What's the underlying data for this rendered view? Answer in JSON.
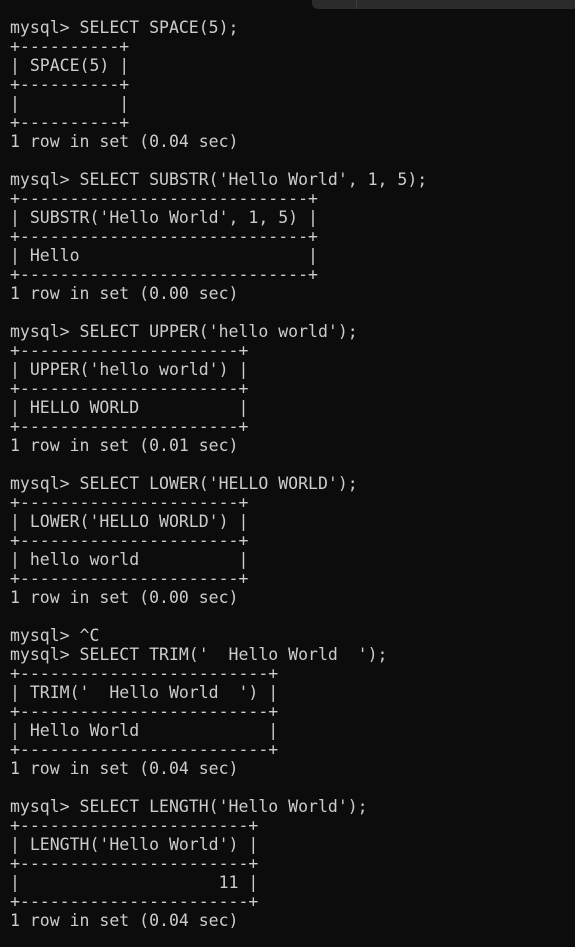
{
  "window": {
    "lines": [
      "mysql> SELECT SPACE(5);",
      "+----------+",
      "| SPACE(5) |",
      "+----------+",
      "|          |",
      "+----------+",
      "1 row in set (0.04 sec)",
      "",
      "mysql> SELECT SUBSTR('Hello World', 1, 5);",
      "+-----------------------------+",
      "| SUBSTR('Hello World', 1, 5) |",
      "+-----------------------------+",
      "| Hello                       |",
      "+-----------------------------+",
      "1 row in set (0.00 sec)",
      "",
      "mysql> SELECT UPPER('hello world');",
      "+----------------------+",
      "| UPPER('hello world') |",
      "+----------------------+",
      "| HELLO WORLD          |",
      "+----------------------+",
      "1 row in set (0.01 sec)",
      "",
      "mysql> SELECT LOWER('HELLO WORLD');",
      "+----------------------+",
      "| LOWER('HELLO WORLD') |",
      "+----------------------+",
      "| hello world          |",
      "+----------------------+",
      "1 row in set (0.00 sec)",
      "",
      "mysql> ^C",
      "mysql> SELECT TRIM('  Hello World  ');",
      "+-------------------------+",
      "| TRIM('  Hello World  ') |",
      "+-------------------------+",
      "| Hello World             |",
      "+-------------------------+",
      "1 row in set (0.04 sec)",
      "",
      "mysql> SELECT LENGTH('Hello World');",
      "+-----------------------+",
      "| LENGTH('Hello World') |",
      "+-----------------------+",
      "|                    11 |",
      "+-----------------------+",
      "1 row in set (0.04 sec)"
    ]
  },
  "colors": {
    "background": "#0c0c0c",
    "text": "#cccccc"
  }
}
